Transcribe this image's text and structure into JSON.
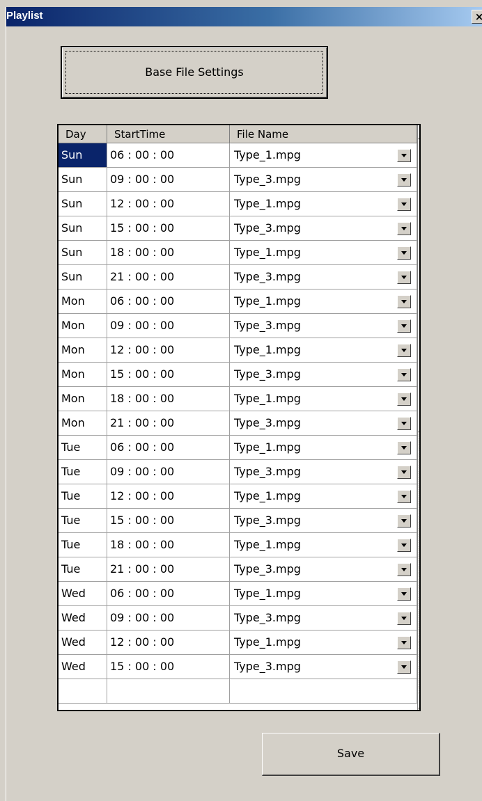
{
  "window": {
    "title": "Playlist",
    "close_label": "×"
  },
  "base_button": {
    "label": "Base File Settings"
  },
  "grid": {
    "columns": {
      "day": "Day",
      "start_time": "StartTime",
      "file_name": "File Name"
    },
    "selected_row": 0,
    "rows": [
      {
        "day": "Sun",
        "time": "06 : 00 : 00",
        "file": "Type_1.mpg"
      },
      {
        "day": "Sun",
        "time": "09 : 00 : 00",
        "file": "Type_3.mpg"
      },
      {
        "day": "Sun",
        "time": "12 : 00 : 00",
        "file": "Type_1.mpg"
      },
      {
        "day": "Sun",
        "time": "15 : 00 : 00",
        "file": "Type_3.mpg"
      },
      {
        "day": "Sun",
        "time": "18 : 00 : 00",
        "file": "Type_1.mpg"
      },
      {
        "day": "Sun",
        "time": "21 : 00 : 00",
        "file": "Type_3.mpg"
      },
      {
        "day": "Mon",
        "time": "06 : 00 : 00",
        "file": "Type_1.mpg"
      },
      {
        "day": "Mon",
        "time": "09 : 00 : 00",
        "file": "Type_3.mpg"
      },
      {
        "day": "Mon",
        "time": "12 : 00 : 00",
        "file": "Type_1.mpg"
      },
      {
        "day": "Mon",
        "time": "15 : 00 : 00",
        "file": "Type_3.mpg"
      },
      {
        "day": "Mon",
        "time": "18 : 00 : 00",
        "file": "Type_1.mpg"
      },
      {
        "day": "Mon",
        "time": "21 : 00 : 00",
        "file": "Type_3.mpg"
      },
      {
        "day": "Tue",
        "time": "06 : 00 : 00",
        "file": "Type_1.mpg"
      },
      {
        "day": "Tue",
        "time": "09 : 00 : 00",
        "file": "Type_3.mpg"
      },
      {
        "day": "Tue",
        "time": "12 : 00 : 00",
        "file": "Type_1.mpg"
      },
      {
        "day": "Tue",
        "time": "15 : 00 : 00",
        "file": "Type_3.mpg"
      },
      {
        "day": "Tue",
        "time": "18 : 00 : 00",
        "file": "Type_1.mpg"
      },
      {
        "day": "Tue",
        "time": "21 : 00 : 00",
        "file": "Type_3.mpg"
      },
      {
        "day": "Wed",
        "time": "06 : 00 : 00",
        "file": "Type_1.mpg"
      },
      {
        "day": "Wed",
        "time": "09 : 00 : 00",
        "file": "Type_3.mpg"
      },
      {
        "day": "Wed",
        "time": "12 : 00 : 00",
        "file": "Type_1.mpg"
      },
      {
        "day": "Wed",
        "time": "15 : 00 : 00",
        "file": "Type_3.mpg"
      },
      {
        "day": "",
        "time": "",
        "file": ""
      }
    ]
  },
  "save_button": {
    "label": "Save"
  },
  "icons": {
    "close": "close-icon",
    "dropdown": "chevron-down-icon",
    "scroll_up": "arrow-up-icon",
    "scroll_down": "arrow-down-icon"
  },
  "colors": {
    "title_gradient_start": "#0a246a",
    "selection": "#0a246a",
    "face": "#d4d0c8"
  }
}
